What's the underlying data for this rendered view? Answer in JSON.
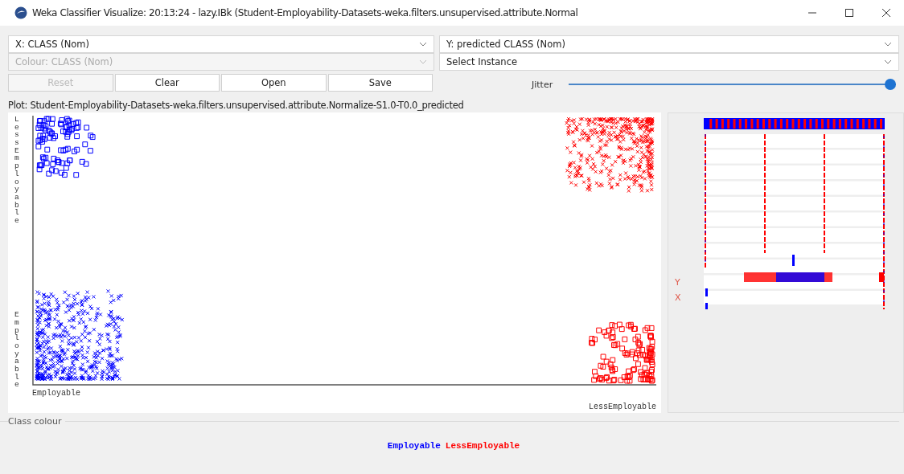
{
  "window": {
    "title": "Weka Classifier Visualize: 20:13:24 - lazy.IBk (Student-Employability-Datasets-weka.filters.unsupervised.attribute.Normal"
  },
  "x_select": {
    "value": "X: CLASS (Nom)",
    "disabled": false
  },
  "colour_select": {
    "value": "Colour: CLASS (Nom)",
    "disabled": true
  },
  "y_select": {
    "value": "Y: predicted CLASS (Nom)",
    "disabled": false
  },
  "instance_select": {
    "value": "Select Instance",
    "disabled": false
  },
  "buttons": [
    {
      "label": "Reset",
      "disabled": true
    },
    {
      "label": "Clear",
      "disabled": false
    },
    {
      "label": "Open",
      "disabled": false
    },
    {
      "label": "Save",
      "disabled": false
    }
  ],
  "jitter": {
    "label": "Jitter",
    "level": 1
  },
  "plot": {
    "title": "Plot: Student-Employability-Datasets-weka.filters.unsupervised.attribute.Normalize-S1.0-T0.0_predicted",
    "y_labels": [
      "LessEmployable",
      "Employable"
    ],
    "x_labels": [
      "Employable",
      "LessEmployable"
    ]
  },
  "attribute_panel": {
    "y_mark": "Y",
    "x_mark": "X"
  },
  "class_colour": {
    "title": "Class colour",
    "classes": [
      {
        "name": "Employable",
        "color": "#0000ff"
      },
      {
        "name": "LessEmployable",
        "color": "#ff0000"
      }
    ]
  }
}
